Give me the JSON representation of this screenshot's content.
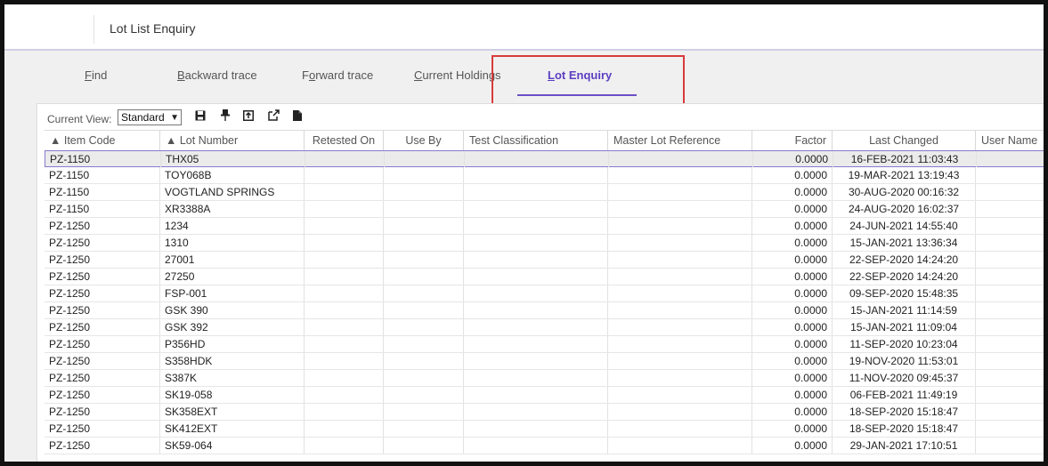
{
  "window": {
    "title": "Lot List Enquiry"
  },
  "tabs": [
    {
      "label": "Find",
      "accel": "F"
    },
    {
      "label": "Backward trace",
      "accel": "B"
    },
    {
      "label": "Forward trace",
      "accel": "o"
    },
    {
      "label": "Current Holdings",
      "accel": "C"
    },
    {
      "label": "Lot Enquiry",
      "accel": "L"
    }
  ],
  "active_tab": "Lot Enquiry",
  "toolbar": {
    "current_view_label": "Current View:",
    "view_value": "Standard"
  },
  "icons": [
    "save-icon",
    "pin-icon",
    "export-icon",
    "open-external-icon",
    "document-icon"
  ],
  "columns": [
    {
      "label": "▲ Item Code"
    },
    {
      "label": "▲ Lot Number"
    },
    {
      "label": "Retested On"
    },
    {
      "label": "Use By"
    },
    {
      "label": "Test Classification"
    },
    {
      "label": "Master Lot Reference"
    },
    {
      "label": "Factor"
    },
    {
      "label": "Last Changed"
    },
    {
      "label": "User Name"
    }
  ],
  "rows": [
    [
      "PZ-1150",
      "THX05",
      "0.0000",
      "16-FEB-2021 11:03:43"
    ],
    [
      "PZ-1150",
      "TOY068B",
      "0.0000",
      "19-MAR-2021 13:19:43"
    ],
    [
      "PZ-1150",
      "VOGTLAND SPRINGS",
      "0.0000",
      "30-AUG-2020 00:16:32"
    ],
    [
      "PZ-1150",
      "XR3388A",
      "0.0000",
      "24-AUG-2020 16:02:37"
    ],
    [
      "PZ-1250",
      "1234",
      "0.0000",
      "24-JUN-2021 14:55:40"
    ],
    [
      "PZ-1250",
      "1310",
      "0.0000",
      "15-JAN-2021 13:36:34"
    ],
    [
      "PZ-1250",
      "27001",
      "0.0000",
      "22-SEP-2020 14:24:20"
    ],
    [
      "PZ-1250",
      "27250",
      "0.0000",
      "22-SEP-2020 14:24:20"
    ],
    [
      "PZ-1250",
      "FSP-001",
      "0.0000",
      "09-SEP-2020 15:48:35"
    ],
    [
      "PZ-1250",
      "GSK 390",
      "0.0000",
      "15-JAN-2021 11:14:59"
    ],
    [
      "PZ-1250",
      "GSK 392",
      "0.0000",
      "15-JAN-2021 11:09:04"
    ],
    [
      "PZ-1250",
      "P356HD",
      "0.0000",
      "11-SEP-2020 10:23:04"
    ],
    [
      "PZ-1250",
      "S358HDK",
      "0.0000",
      "19-NOV-2020 11:53:01"
    ],
    [
      "PZ-1250",
      "S387K",
      "0.0000",
      "11-NOV-2020 09:45:37"
    ],
    [
      "PZ-1250",
      "SK19-058",
      "0.0000",
      "06-FEB-2021 11:49:19"
    ],
    [
      "PZ-1250",
      "SK358EXT",
      "0.0000",
      "18-SEP-2020 15:18:47"
    ],
    [
      "PZ-1250",
      "SK412EXT",
      "0.0000",
      "18-SEP-2020 15:18:47"
    ],
    [
      "PZ-1250",
      "SK59-064",
      "0.0000",
      "29-JAN-2021 17:10:51"
    ]
  ],
  "colors": {
    "accent": "#5c3ec2",
    "highlight_box": "#d93b3b",
    "selected_row": "#ebebeb"
  }
}
